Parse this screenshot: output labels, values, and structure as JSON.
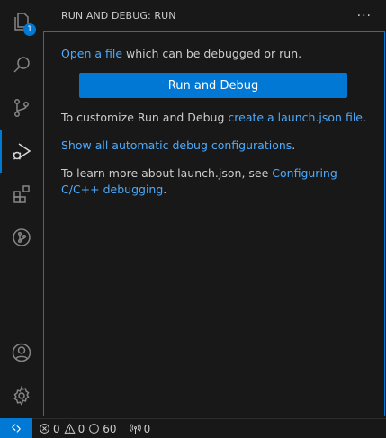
{
  "activity_bar": {
    "explorer_badge": "1"
  },
  "sidebar": {
    "title": "RUN AND DEBUG: RUN",
    "more_label": "···"
  },
  "welcome": {
    "open_file_link": "Open a file",
    "open_file_rest": " which can be debugged or run.",
    "run_button_label": "Run and Debug",
    "customize_text": "To customize Run and Debug ",
    "launch_link": "create a launch.json file",
    "customize_end": ".",
    "show_all_link": "Show all automatic debug configurations",
    "show_all_end": ".",
    "learn_text": "To learn more about launch.json, see ",
    "learn_link": "Configuring C/C++ debugging",
    "learn_end": "."
  },
  "status_bar": {
    "errors": "0",
    "warnings": "0",
    "info": "60",
    "ports": "0"
  },
  "colors": {
    "accent": "#0078d4",
    "link": "#4daafc",
    "background": "#181818"
  }
}
